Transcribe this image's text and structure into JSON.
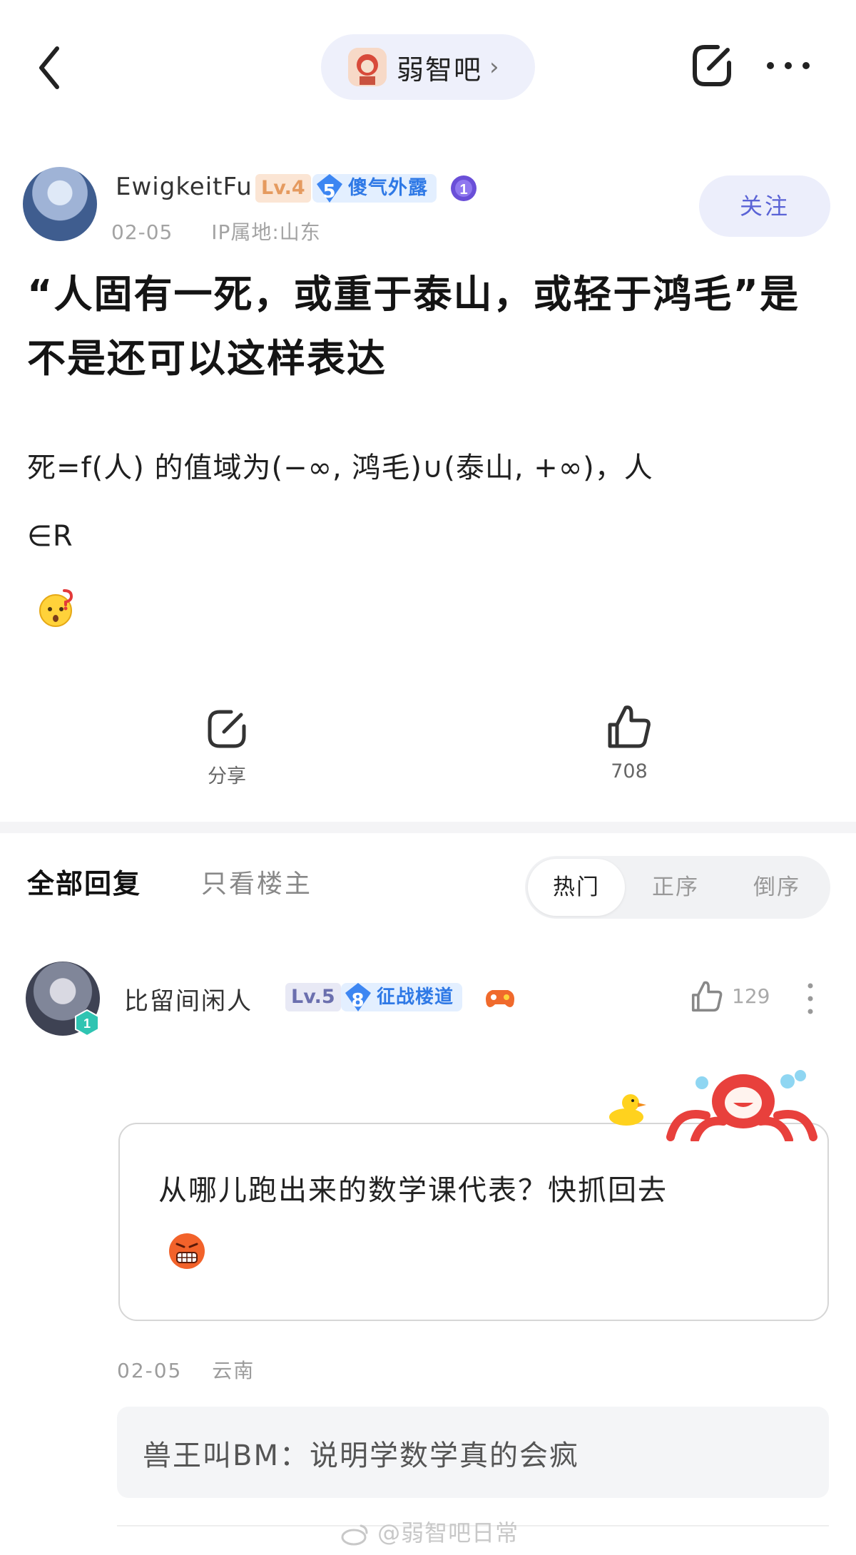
{
  "header": {
    "forum_name": "弱智吧",
    "forum_chevron": "›"
  },
  "post": {
    "author": "EwigkeitFu",
    "level": "Lv.4",
    "title_badge_number": "5",
    "title_badge": "傻气外露",
    "medal_number": "1",
    "date": "02-05",
    "ip_location": "IP属地:山东",
    "follow_label": "关注",
    "title": "“人固有一死，或重于泰山，或轻于鸿毛”是不是还可以这样表达",
    "body_line1": "死=f(人) 的值域为(−∞, 鸿毛)∪(泰山, +∞)，人",
    "body_line2": "∈R",
    "share_label": "分享",
    "like_count": "708"
  },
  "replies_header": {
    "tab_all": "全部回复",
    "tab_op_only": "只看楼主",
    "sort_hot": "热门",
    "sort_asc": "正序",
    "sort_desc": "倒序"
  },
  "comment": {
    "author": "比留间闲人",
    "level": "Lv.5",
    "title_badge_number": "8",
    "title_badge": "征战楼道",
    "avatar_badge_number": "1",
    "like_count": "129",
    "text": "从哪儿跑出来的数学课代表？快抓回去",
    "date": "02-05",
    "location": "云南",
    "sub_reply": "兽王叫BM：说明学数学真的会疯"
  },
  "watermark": "@弱智吧日常",
  "colors": {
    "accent": "#5a63d6",
    "badge_blue": "#2f79e6",
    "level_orange": "#e59a5f",
    "pill_bg": "#eef0fb"
  }
}
